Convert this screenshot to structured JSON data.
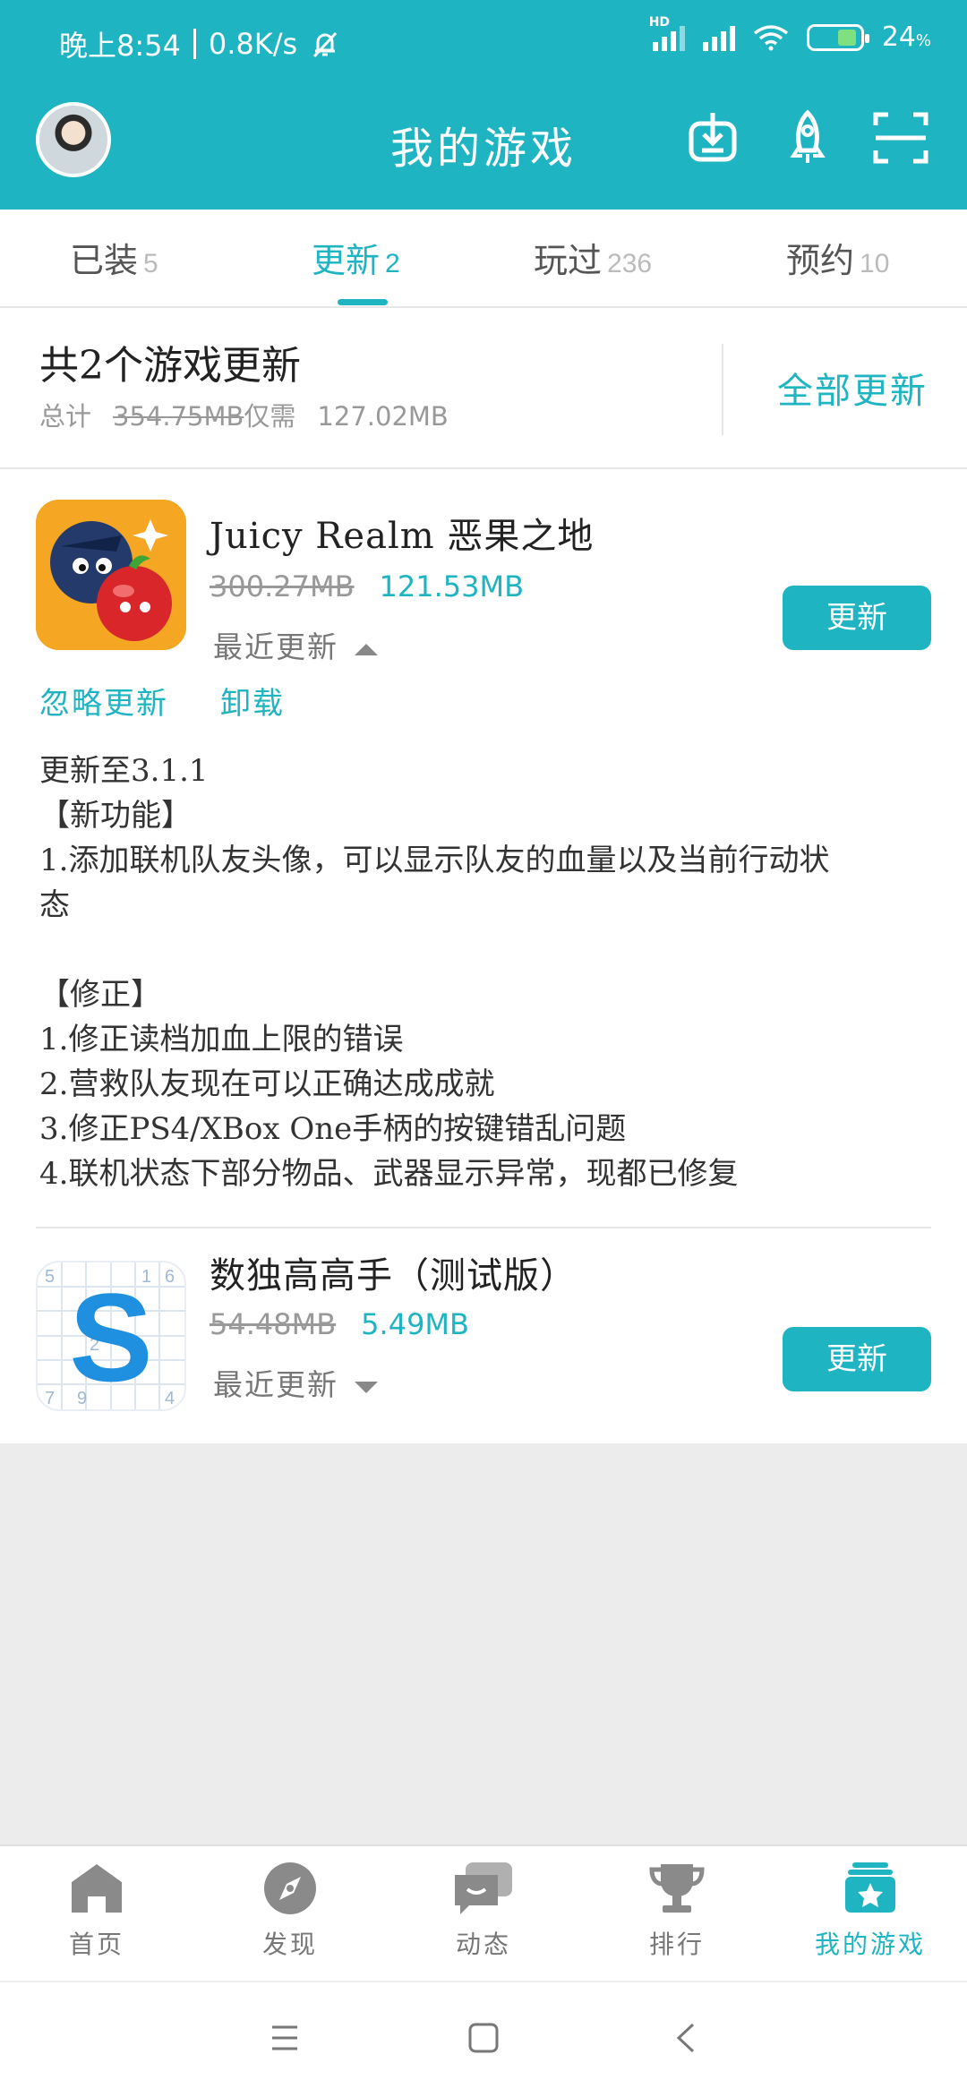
{
  "status_bar": {
    "time": "晚上8:54",
    "speed": "0.8K/s",
    "hd_label": "HD",
    "battery": "24"
  },
  "header": {
    "title": "我的游戏"
  },
  "tabs": [
    {
      "label": "已装",
      "count": "5"
    },
    {
      "label": "更新",
      "count": "2",
      "active": true
    },
    {
      "label": "玩过",
      "count": "236"
    },
    {
      "label": "预约",
      "count": "10"
    }
  ],
  "summary": {
    "title": "共2个游戏更新",
    "total_label": "总计",
    "total_original": "354.75MB",
    "need_label": "仅需",
    "total_needed": "127.02MB",
    "update_all_label": "全部更新"
  },
  "games": [
    {
      "name": "Juicy Realm 恶果之地",
      "old_size": "300.27MB",
      "new_size": "121.53MB",
      "recent_label": "最近更新",
      "update_label": "更新",
      "ignore_label": "忽略更新",
      "uninstall_label": "卸载",
      "notes": [
        "更新至3.1.1",
        "【新功能】",
        "1.添加联机队友头像，可以显示队友的血量以及当前行动状",
        "态",
        "",
        "【修正】",
        "1.修正读档加血上限的错误",
        "2.营救队友现在可以正确达成成就",
        "3.修正PS4/XBox One手柄的按键错乱问题",
        "4.联机状态下部分物品、武器显示异常，现都已修复"
      ]
    },
    {
      "name": "数独高高手（测试版）",
      "old_size": "54.48MB",
      "new_size": "5.49MB",
      "recent_label": "最近更新",
      "update_label": "更新",
      "icon_letter": "S",
      "icon_digits": [
        "5",
        "1",
        "6",
        "2",
        "7",
        "9",
        "4"
      ]
    }
  ],
  "bottom_nav": [
    {
      "label": "首页",
      "icon": "home-icon"
    },
    {
      "label": "发现",
      "icon": "compass-icon"
    },
    {
      "label": "动态",
      "icon": "chat-icon"
    },
    {
      "label": "排行",
      "icon": "trophy-icon"
    },
    {
      "label": "我的游戏",
      "icon": "my-games-icon",
      "active": true
    }
  ],
  "colors": {
    "accent": "#1fb4c2",
    "background": "#ececec"
  }
}
